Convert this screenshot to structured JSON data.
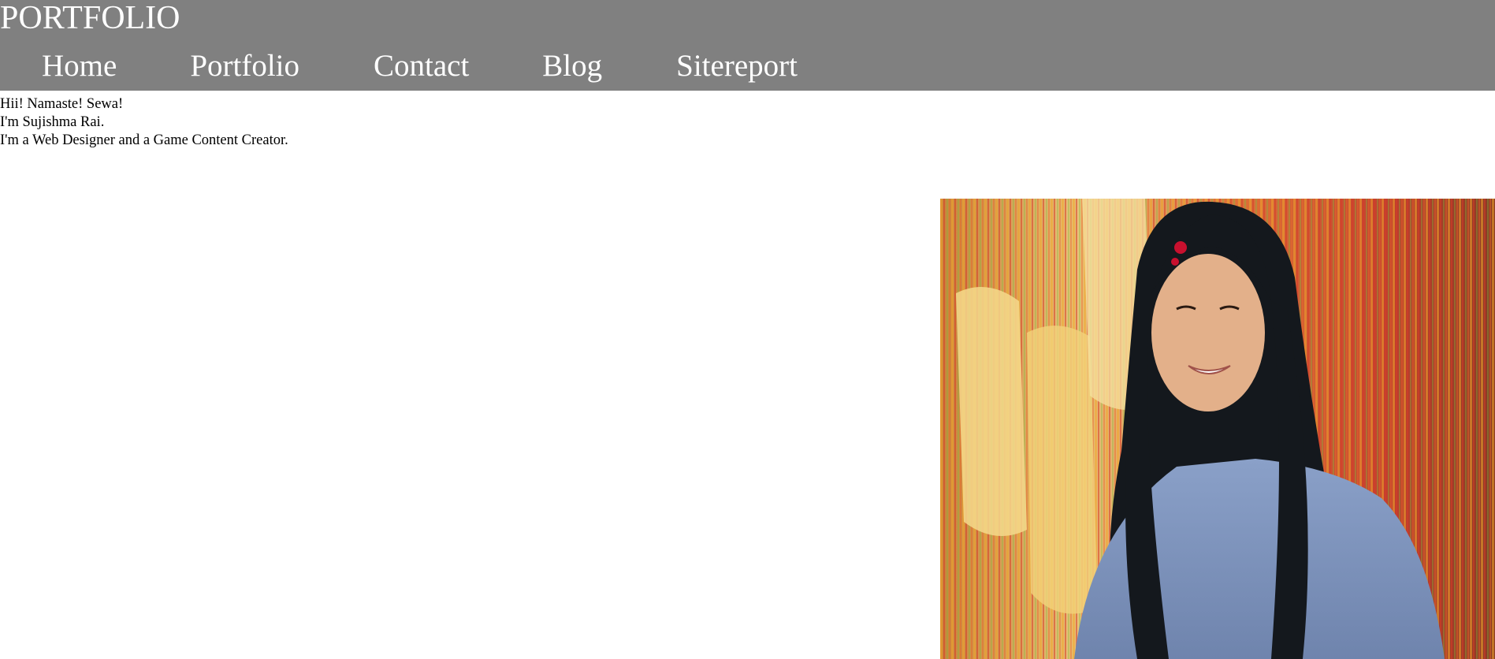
{
  "header": {
    "title": "PORTFOLIO",
    "background_color": "#808080",
    "text_color": "#ffffff"
  },
  "nav": {
    "items": [
      {
        "label": "Home"
      },
      {
        "label": "Portfolio"
      },
      {
        "label": "Contact"
      },
      {
        "label": "Blog"
      },
      {
        "label": "Sitereport"
      }
    ]
  },
  "intro": {
    "line1": "Hii! Namaste! Sewa!",
    "line2": "I'm Sujishma Rai.",
    "line3": "I'm a Web Designer and a Game Content Creator."
  },
  "photo": {
    "subject": "portrait-photo"
  }
}
